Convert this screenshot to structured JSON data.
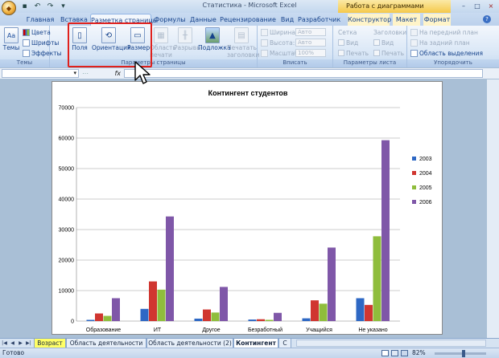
{
  "window": {
    "title": "Статистика - Microsoft Excel",
    "context_title": "Работа с диаграммами",
    "minimize": "–",
    "maximize": "□",
    "close": "×"
  },
  "tabs": [
    {
      "label": "Главная"
    },
    {
      "label": "Вставка"
    },
    {
      "label": "Разметка страницы",
      "active": true
    },
    {
      "label": "Формулы"
    },
    {
      "label": "Данные"
    },
    {
      "label": "Рецензирование"
    },
    {
      "label": "Вид"
    },
    {
      "label": "Разработчик"
    },
    {
      "label": "Конструктор"
    },
    {
      "label": "Макет"
    },
    {
      "label": "Формат"
    }
  ],
  "ribbon": {
    "themes": {
      "big": "Темы",
      "colors": "Цвета",
      "fonts": "Шрифты",
      "effects": "Эффекты",
      "label": "Темы"
    },
    "page_setup": {
      "margins": "Поля",
      "orientation": "Ориентация",
      "size": "Размер",
      "print_area": "Область печати",
      "breaks": "Разрывы",
      "background": "Подложка",
      "print_titles": "Печатать заголовки",
      "label": "Параметры страницы"
    },
    "scale": {
      "width": "Ширина:",
      "width_value": "Авто",
      "height": "Высота:",
      "height_value": "Авто",
      "scale": "Масштаб:",
      "scale_value": "100%",
      "label": "Вписать"
    },
    "sheet_options": {
      "grid": "Сетка",
      "headings": "Заголовки",
      "view": "Вид",
      "print": "Печать",
      "label": "Параметры листа"
    },
    "arrange": {
      "bring_front": "На передний план",
      "send_back": "На задний план",
      "selection_pane": "Область выделения",
      "label": "Упорядочить"
    }
  },
  "formula_bar": {
    "fx": "fx"
  },
  "chart_data": {
    "type": "bar",
    "title": "Контингент студентов",
    "categories": [
      "Образование",
      "ИТ",
      "Другое",
      "Безработный",
      "Учащийся",
      "Не указано"
    ],
    "series": [
      {
        "name": "2003",
        "color": "#2e68c4",
        "values": [
          400,
          4000,
          800,
          500,
          900,
          7500
        ]
      },
      {
        "name": "2004",
        "color": "#d03630",
        "values": [
          2500,
          13000,
          3800,
          600,
          6800,
          5300
        ]
      },
      {
        "name": "2005",
        "color": "#8fbd3c",
        "values": [
          1700,
          10300,
          2800,
          400,
          5700,
          27800
        ]
      },
      {
        "name": "2006",
        "color": "#7f57a8",
        "values": [
          7500,
          34300,
          11200,
          2700,
          24100,
          59300
        ]
      }
    ],
    "ylim": [
      0,
      70000
    ],
    "yticks": [
      "0",
      "10000",
      "20000",
      "30000",
      "40000",
      "50000",
      "60000",
      "70000"
    ],
    "grid": true,
    "legend": "right"
  },
  "sheets": [
    {
      "label": "Возраст",
      "style": "yellow"
    },
    {
      "label": "Область деятельности",
      "style": "normal"
    },
    {
      "label": "Область деятельности (2)",
      "style": "normal"
    },
    {
      "label": "Контингент",
      "style": "active"
    },
    {
      "label": "С",
      "style": "normal"
    }
  ],
  "status": {
    "ready": "Готово",
    "zoom": "82%"
  }
}
